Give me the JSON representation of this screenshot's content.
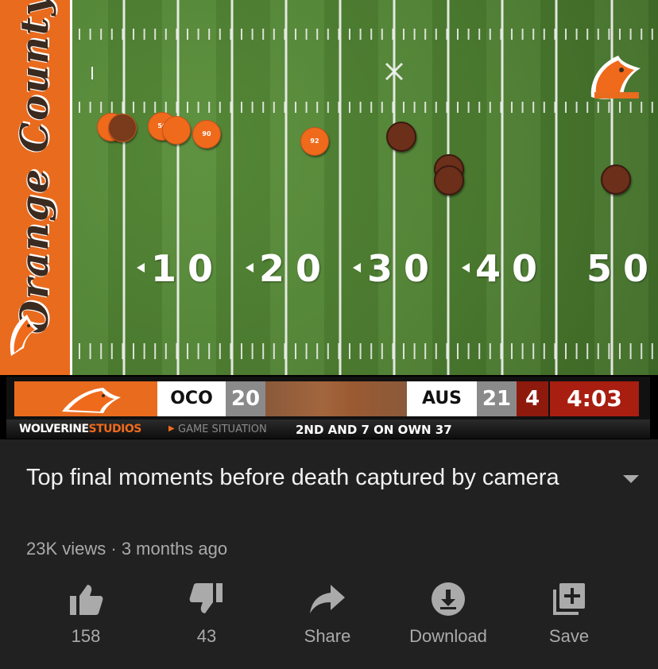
{
  "video": {
    "field": {
      "endzone_text": "Orange County",
      "yard_numbers": [
        "10",
        "20",
        "30",
        "40",
        "50"
      ],
      "players": [
        {
          "team": "orange",
          "number": ""
        },
        {
          "team": "orange",
          "number": ""
        },
        {
          "team": "orange",
          "number": "56"
        },
        {
          "team": "orange",
          "number": ""
        },
        {
          "team": "orange",
          "number": "90"
        },
        {
          "team": "orange",
          "number": "92"
        },
        {
          "team": "brown",
          "number": ""
        },
        {
          "team": "brown",
          "number": ""
        },
        {
          "team": "brown",
          "number": ""
        },
        {
          "team": "brown",
          "number": ""
        }
      ]
    },
    "scoreboard": {
      "home_team": "OCO",
      "home_score": "20",
      "away_team": "AUS",
      "away_score": "21",
      "quarter": "4",
      "clock": "4:03"
    },
    "ticker": {
      "brand_prefix": "WOLVERINE",
      "brand_suffix": "STUDIOS",
      "label": "GAME SITUATION",
      "value": "2ND AND 7 ON OWN 37"
    }
  },
  "title": "Top final moments before death captured by camera",
  "meta": "23K views · 3 months ago",
  "actions": {
    "like": {
      "label": "158",
      "icon": "thumbs-up-icon"
    },
    "dislike": {
      "label": "43",
      "icon": "thumbs-down-icon"
    },
    "share": {
      "label": "Share",
      "icon": "share-icon"
    },
    "download": {
      "label": "Download",
      "icon": "download-icon"
    },
    "save": {
      "label": "Save",
      "icon": "playlist-add-icon"
    }
  },
  "colors": {
    "background": "#212121",
    "title": "#f1f1f1",
    "secondary_text": "#aaaaaa",
    "team_orange": "#e96b1e",
    "clock_red": "#a81e10"
  }
}
